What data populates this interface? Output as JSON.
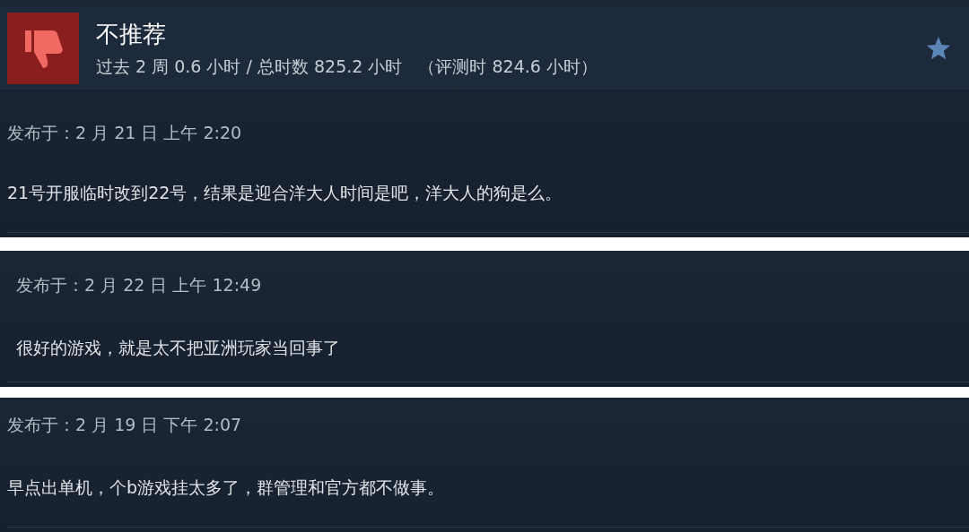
{
  "header": {
    "verdict": "不推荐",
    "recommended": false,
    "hours": "过去 2 周 0.6 小时 / 总时数 825.2 小时",
    "review_hours": "（评测时 824.6 小时）"
  },
  "reviews": [
    {
      "posted": "发布于：2 月 21 日 上午 2:20",
      "text": "21号开服临时改到22号，结果是迎合洋大人时间是吧，洋大人的狗是么。"
    },
    {
      "posted": "发布于：2 月 22 日 上午 12:49",
      "text": "很好的游戏，就是太不把亚洲玩家当回事了"
    },
    {
      "posted": "发布于：2 月 19 日 下午 2:07",
      "text": "早点出单机，个b游戏挂太多了，群管理和官方都不做事。"
    }
  ]
}
